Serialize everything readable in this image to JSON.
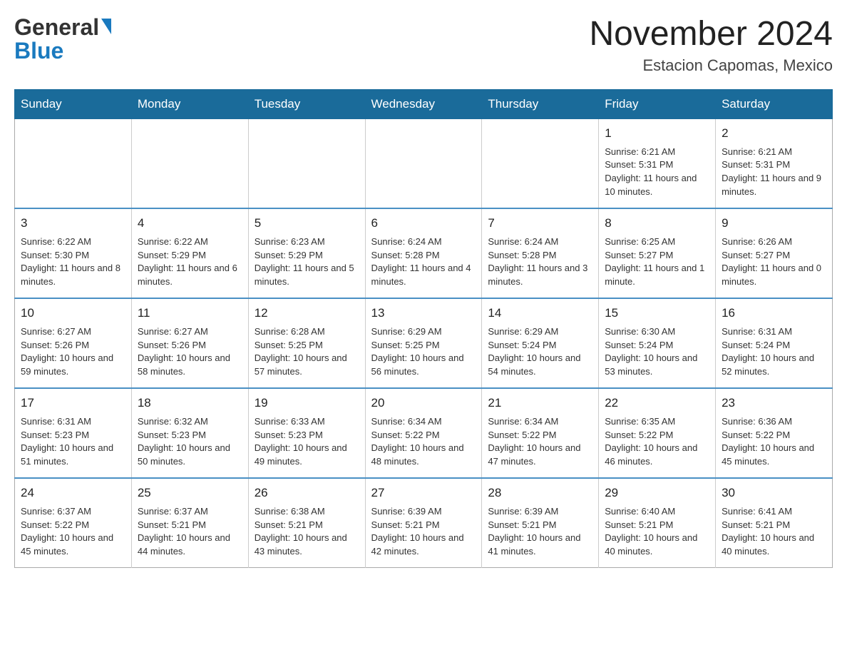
{
  "header": {
    "logo": {
      "line1": "General",
      "line2": "Blue"
    },
    "title": "November 2024",
    "location": "Estacion Capomas, Mexico"
  },
  "weekdays": [
    "Sunday",
    "Monday",
    "Tuesday",
    "Wednesday",
    "Thursday",
    "Friday",
    "Saturday"
  ],
  "weeks": [
    [
      {
        "day": "",
        "info": ""
      },
      {
        "day": "",
        "info": ""
      },
      {
        "day": "",
        "info": ""
      },
      {
        "day": "",
        "info": ""
      },
      {
        "day": "",
        "info": ""
      },
      {
        "day": "1",
        "info": "Sunrise: 6:21 AM\nSunset: 5:31 PM\nDaylight: 11 hours and 10 minutes."
      },
      {
        "day": "2",
        "info": "Sunrise: 6:21 AM\nSunset: 5:31 PM\nDaylight: 11 hours and 9 minutes."
      }
    ],
    [
      {
        "day": "3",
        "info": "Sunrise: 6:22 AM\nSunset: 5:30 PM\nDaylight: 11 hours and 8 minutes."
      },
      {
        "day": "4",
        "info": "Sunrise: 6:22 AM\nSunset: 5:29 PM\nDaylight: 11 hours and 6 minutes."
      },
      {
        "day": "5",
        "info": "Sunrise: 6:23 AM\nSunset: 5:29 PM\nDaylight: 11 hours and 5 minutes."
      },
      {
        "day": "6",
        "info": "Sunrise: 6:24 AM\nSunset: 5:28 PM\nDaylight: 11 hours and 4 minutes."
      },
      {
        "day": "7",
        "info": "Sunrise: 6:24 AM\nSunset: 5:28 PM\nDaylight: 11 hours and 3 minutes."
      },
      {
        "day": "8",
        "info": "Sunrise: 6:25 AM\nSunset: 5:27 PM\nDaylight: 11 hours and 1 minute."
      },
      {
        "day": "9",
        "info": "Sunrise: 6:26 AM\nSunset: 5:27 PM\nDaylight: 11 hours and 0 minutes."
      }
    ],
    [
      {
        "day": "10",
        "info": "Sunrise: 6:27 AM\nSunset: 5:26 PM\nDaylight: 10 hours and 59 minutes."
      },
      {
        "day": "11",
        "info": "Sunrise: 6:27 AM\nSunset: 5:26 PM\nDaylight: 10 hours and 58 minutes."
      },
      {
        "day": "12",
        "info": "Sunrise: 6:28 AM\nSunset: 5:25 PM\nDaylight: 10 hours and 57 minutes."
      },
      {
        "day": "13",
        "info": "Sunrise: 6:29 AM\nSunset: 5:25 PM\nDaylight: 10 hours and 56 minutes."
      },
      {
        "day": "14",
        "info": "Sunrise: 6:29 AM\nSunset: 5:24 PM\nDaylight: 10 hours and 54 minutes."
      },
      {
        "day": "15",
        "info": "Sunrise: 6:30 AM\nSunset: 5:24 PM\nDaylight: 10 hours and 53 minutes."
      },
      {
        "day": "16",
        "info": "Sunrise: 6:31 AM\nSunset: 5:24 PM\nDaylight: 10 hours and 52 minutes."
      }
    ],
    [
      {
        "day": "17",
        "info": "Sunrise: 6:31 AM\nSunset: 5:23 PM\nDaylight: 10 hours and 51 minutes."
      },
      {
        "day": "18",
        "info": "Sunrise: 6:32 AM\nSunset: 5:23 PM\nDaylight: 10 hours and 50 minutes."
      },
      {
        "day": "19",
        "info": "Sunrise: 6:33 AM\nSunset: 5:23 PM\nDaylight: 10 hours and 49 minutes."
      },
      {
        "day": "20",
        "info": "Sunrise: 6:34 AM\nSunset: 5:22 PM\nDaylight: 10 hours and 48 minutes."
      },
      {
        "day": "21",
        "info": "Sunrise: 6:34 AM\nSunset: 5:22 PM\nDaylight: 10 hours and 47 minutes."
      },
      {
        "day": "22",
        "info": "Sunrise: 6:35 AM\nSunset: 5:22 PM\nDaylight: 10 hours and 46 minutes."
      },
      {
        "day": "23",
        "info": "Sunrise: 6:36 AM\nSunset: 5:22 PM\nDaylight: 10 hours and 45 minutes."
      }
    ],
    [
      {
        "day": "24",
        "info": "Sunrise: 6:37 AM\nSunset: 5:22 PM\nDaylight: 10 hours and 45 minutes."
      },
      {
        "day": "25",
        "info": "Sunrise: 6:37 AM\nSunset: 5:21 PM\nDaylight: 10 hours and 44 minutes."
      },
      {
        "day": "26",
        "info": "Sunrise: 6:38 AM\nSunset: 5:21 PM\nDaylight: 10 hours and 43 minutes."
      },
      {
        "day": "27",
        "info": "Sunrise: 6:39 AM\nSunset: 5:21 PM\nDaylight: 10 hours and 42 minutes."
      },
      {
        "day": "28",
        "info": "Sunrise: 6:39 AM\nSunset: 5:21 PM\nDaylight: 10 hours and 41 minutes."
      },
      {
        "day": "29",
        "info": "Sunrise: 6:40 AM\nSunset: 5:21 PM\nDaylight: 10 hours and 40 minutes."
      },
      {
        "day": "30",
        "info": "Sunrise: 6:41 AM\nSunset: 5:21 PM\nDaylight: 10 hours and 40 minutes."
      }
    ]
  ]
}
